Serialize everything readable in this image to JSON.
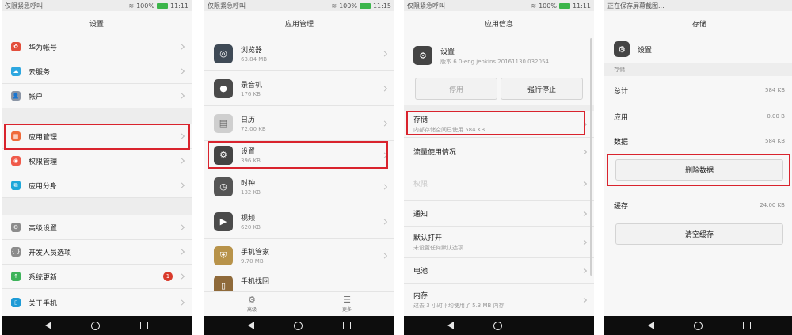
{
  "status": {
    "s1_left": "仅限紧急呼叫",
    "s1_right": "100%",
    "s1_time": "11:11",
    "s2_left": "仅限紧急呼叫",
    "s2_right": "100%",
    "s2_time": "11:15",
    "s3_left": "仅限紧急呼叫",
    "s3_right": "100%",
    "s3_time": "11:11",
    "s4_left": "正在保存屏幕截图..."
  },
  "screen1": {
    "title": "设置",
    "items": [
      {
        "label": "华为帐号",
        "icon": "huawei-icon",
        "color": "#e34f3c"
      },
      {
        "label": "云服务",
        "icon": "cloud-icon",
        "color": "#2ea7e0"
      },
      {
        "label": "帐户",
        "icon": "account-icon",
        "color": "#8b95a5"
      },
      {
        "label": "应用管理",
        "icon": "apps-icon",
        "color": "#ef6a3a"
      },
      {
        "label": "权限管理",
        "icon": "permission-icon",
        "color": "#f05a4a"
      },
      {
        "label": "应用分身",
        "icon": "app-twin-icon",
        "color": "#1ea7d9"
      },
      {
        "label": "高级设置",
        "icon": "gear-icon",
        "color": "#8c8c8c"
      },
      {
        "label": "开发人员选项",
        "icon": "developer-icon",
        "color": "#8c8c8c"
      },
      {
        "label": "系统更新",
        "icon": "update-icon",
        "color": "#3db35a",
        "badge": "1"
      },
      {
        "label": "关于手机",
        "icon": "phone-info-icon",
        "color": "#1e9bd6"
      }
    ]
  },
  "screen2": {
    "title": "应用管理",
    "apps": [
      {
        "name": "浏览器",
        "size": "63.84 MB",
        "icon": "browser-icon",
        "color": "#3f4a56"
      },
      {
        "name": "录音机",
        "size": "176 KB",
        "icon": "recorder-icon",
        "color": "#4a4a4a"
      },
      {
        "name": "日历",
        "size": "72.00 KB",
        "icon": "calendar-icon",
        "color": "#cfcfcf"
      },
      {
        "name": "设置",
        "size": "396 KB",
        "icon": "gear-icon",
        "color": "#444444"
      },
      {
        "name": "时钟",
        "size": "132 KB",
        "icon": "clock-icon",
        "color": "#555555"
      },
      {
        "name": "视频",
        "size": "620 KB",
        "icon": "video-icon",
        "color": "#4b4b4b"
      },
      {
        "name": "手机管家",
        "size": "9.70 MB",
        "icon": "shield-icon",
        "color": "#b8934a"
      },
      {
        "name": "手机找回",
        "size": "",
        "icon": "phone-finder-icon",
        "color": "#8f6a3a"
      }
    ],
    "tab_advanced": "高级",
    "tab_more": "更多"
  },
  "screen3": {
    "title": "应用信息",
    "app_name": "设置",
    "app_version": "版本 6.0-eng.jenkins.20161130.032054",
    "disable_label": "停用",
    "force_stop_label": "强行停止",
    "items": [
      {
        "label": "存储",
        "sub": "内部存储空间已使用 584 KB"
      },
      {
        "label": "流量使用情况",
        "sub": ""
      },
      {
        "label": "权限",
        "sub": "",
        "disabled": true
      },
      {
        "label": "通知",
        "sub": ""
      },
      {
        "label": "默认打开",
        "sub": "未设置任何默认选项"
      },
      {
        "label": "电池",
        "sub": ""
      },
      {
        "label": "内存",
        "sub": "过去 3 小时平均使用了 5.3 MB 内存"
      }
    ]
  },
  "screen4": {
    "title": "存储",
    "app_name": "设置",
    "section": "存储",
    "total_label": "总计",
    "total_value": "584 KB",
    "app_label": "应用",
    "app_value": "0.00 B",
    "data_label": "数据",
    "data_value": "584 KB",
    "clear_data_label": "删除数据",
    "cache_label": "缓存",
    "cache_value": "24.00 KB",
    "clear_cache_label": "清空缓存"
  },
  "colors": {
    "highlight": "#d9232d",
    "accent_green": "#3bb54a"
  }
}
